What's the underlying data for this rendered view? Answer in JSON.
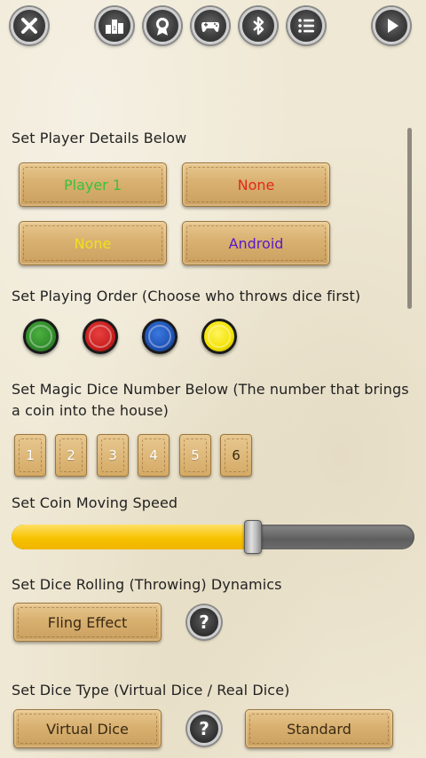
{
  "toolbar": {
    "icons": [
      "close-icon",
      "leaderboard-icon",
      "award-icon",
      "gamepad-icon",
      "bluetooth-icon",
      "menu-list-icon",
      "play-icon"
    ]
  },
  "players": {
    "heading": "Set Player Details Below",
    "slots": [
      {
        "label": "Player 1",
        "color": "#3ac23a"
      },
      {
        "label": "None",
        "color": "#e02a1a"
      },
      {
        "label": "None",
        "color": "#f0e020"
      },
      {
        "label": "Android",
        "color": "#5a18c8"
      }
    ]
  },
  "order": {
    "heading": "Set Playing Order (Choose who throws dice first)",
    "coins": [
      {
        "name": "green",
        "color": "#2f8a2a"
      },
      {
        "name": "red",
        "color": "#c81e1e"
      },
      {
        "name": "blue",
        "color": "#1e52b4"
      },
      {
        "name": "yellow",
        "color": "#f2e200"
      }
    ]
  },
  "magic": {
    "heading": "Set Magic Dice Number Below (The number that brings a coin into the house)",
    "numbers": [
      "1",
      "2",
      "3",
      "4",
      "5",
      "6"
    ],
    "selected": "6"
  },
  "speed": {
    "heading": "Set Coin Moving Speed",
    "value": 0.6
  },
  "dynamics": {
    "heading": "Set Dice Rolling (Throwing) Dynamics",
    "button": "Fling Effect",
    "help": "?"
  },
  "dicetype": {
    "heading": "Set Dice Type (Virtual Dice / Real Dice)",
    "button": "Virtual Dice",
    "help": "?",
    "style": "Standard"
  }
}
